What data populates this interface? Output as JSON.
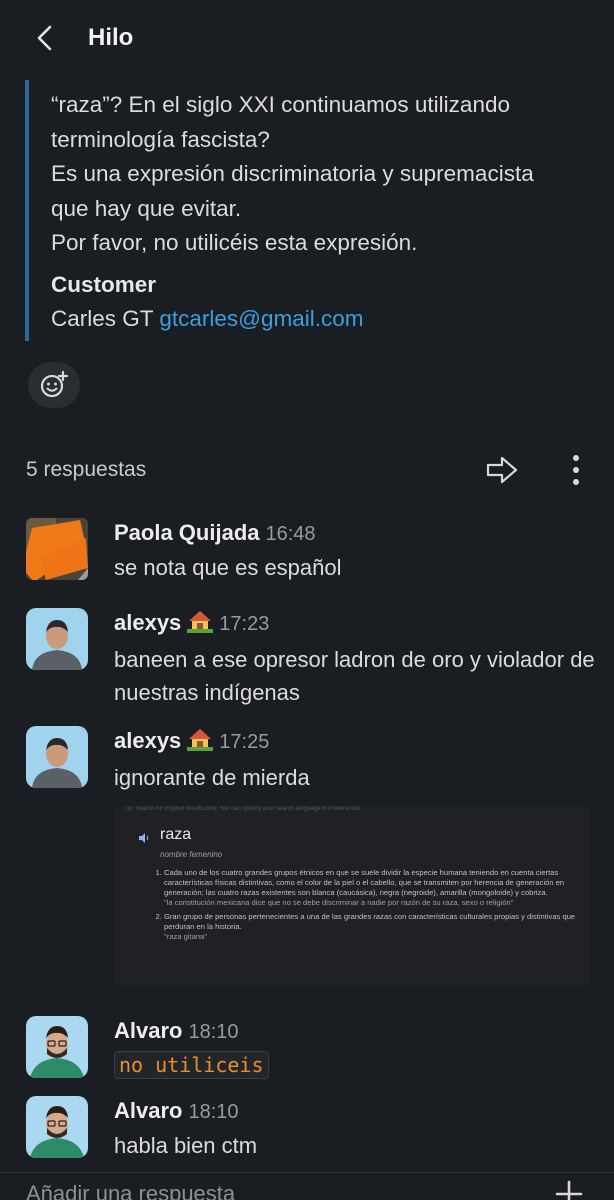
{
  "header": {
    "title": "Hilo"
  },
  "parent_message": {
    "lines": "“raza”? En el siglo XXI continuamos utilizando\nterminología fascista?\nEs una expresión discriminatoria y supremacista\nque hay que evitar.\nPor favor, no utilicéis esta expresión.",
    "label": "Customer",
    "sender_name": "Carles GT",
    "sender_email": "gtcarles@gmail.com"
  },
  "thread": {
    "replies_label": "5 respuestas"
  },
  "messages": [
    {
      "name": "Paola Quijada",
      "time": "16:48",
      "text": "se nota que es español"
    },
    {
      "name": "alexys",
      "time": "17:23",
      "text": "baneen a ese opresor ladron de oro y violador de nuestras indígenas"
    },
    {
      "name": "alexys",
      "time": "17:25",
      "text": "ignorante de mierda"
    },
    {
      "name": "Alvaro",
      "time": "18:10",
      "text": "no utiliceis"
    },
    {
      "name": "Alvaro",
      "time": "18:10",
      "text": "habla bien ctm"
    }
  ],
  "attachment": {
    "topline": "Tip: Search for English results only. You can specify your search language in Preferences",
    "word": "raza",
    "part_of_speech": "nombre femenino",
    "def1": "Cada uno de los cuatro grandes grupos étnicos en que se suele dividir la especie humana teniendo en cuenta ciertas características físicas distintivas, como el color de la piel o el cabello, que se transmiten por herencia de generación en generación; las cuatro razas existentes son blanca (caucásica), negra (negroide), amarilla (mongoloide) y cobriza.",
    "ex1": "\"la constitución mexicana dice que no se debe discriminar a nadie por razón de su raza, sexo o religión\"",
    "def2": "Gran grupo de personas pertenecientes a una de las grandes razas con características culturales propias y distintivas que perduran en la historia.",
    "ex2": "\"raza gitana\""
  },
  "composer": {
    "placeholder": "Añadir una respuesta"
  },
  "colors": {
    "background": "#1a1d21",
    "link": "#3a9fe0",
    "quote_bar": "#2b6a97",
    "code": "#e8912d"
  }
}
